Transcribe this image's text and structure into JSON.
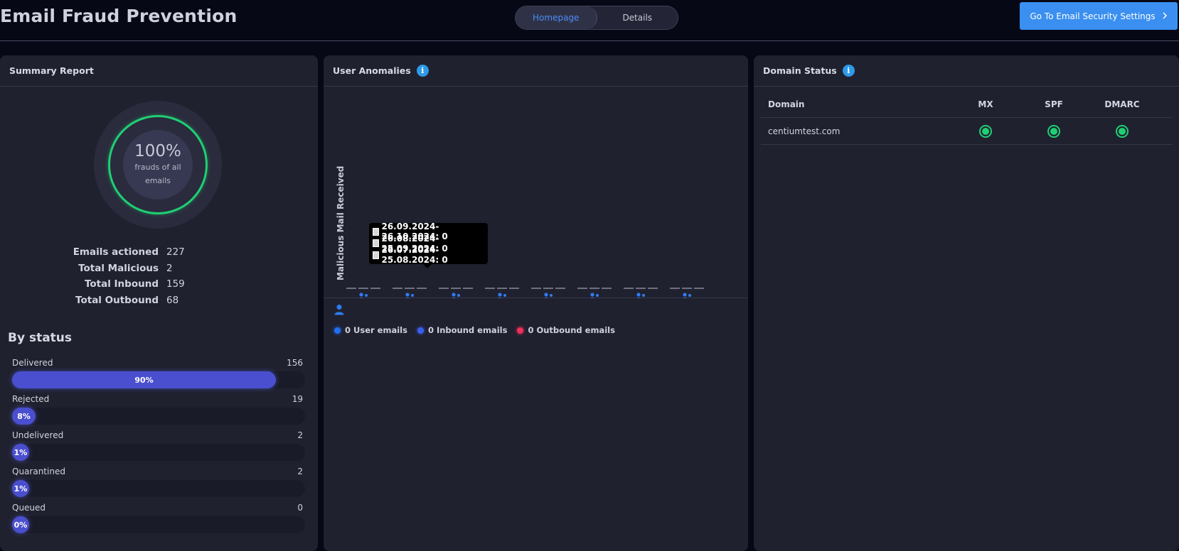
{
  "header": {
    "title": "Email Fraud Prevention",
    "tabs": [
      {
        "label": "Homepage",
        "active": true
      },
      {
        "label": "Details",
        "active": false
      }
    ],
    "settings_button": "Go To Email Security Settings"
  },
  "summary": {
    "title": "Summary Report",
    "donut_pct": "100%",
    "donut_caption": "frauds of all emails",
    "stats": [
      {
        "label": "Emails actioned",
        "value": "227"
      },
      {
        "label": "Total Malicious",
        "value": "2"
      },
      {
        "label": "Total Inbound",
        "value": "159"
      },
      {
        "label": "Total Outbound",
        "value": "68"
      }
    ],
    "by_status_title": "By status",
    "statuses": [
      {
        "label": "Delivered",
        "count": "156",
        "pct": "90%",
        "fraction": 0.9
      },
      {
        "label": "Rejected",
        "count": "19",
        "pct": "8%",
        "fraction": 0.08
      },
      {
        "label": "Undelivered",
        "count": "2",
        "pct": "1%",
        "fraction": 0.01
      },
      {
        "label": "Quarantined",
        "count": "2",
        "pct": "1%",
        "fraction": 0.01
      },
      {
        "label": "Queued",
        "count": "0",
        "pct": "0%",
        "fraction": 0.0
      }
    ]
  },
  "anomalies": {
    "title": "User Anomalies",
    "y_label": "Malicious Mail Received",
    "tooltip": [
      "26.09.2024-26.10.2024: 0",
      "26.08.2024-25.09.2024: 0",
      "26.07.2024-25.08.2024: 0"
    ],
    "legend": [
      {
        "label": "0 User emails",
        "color": "#1f6ff0"
      },
      {
        "label": "0 Inbound emails",
        "color": "#3a5ff0"
      },
      {
        "label": "0 Outbound emails",
        "color": "#f0305a"
      }
    ],
    "user_groups": 8,
    "bars_per_group": 3
  },
  "domain": {
    "title": "Domain Status",
    "columns": [
      "Domain",
      "MX",
      "SPF",
      "DMARC"
    ],
    "rows": [
      {
        "domain": "centiumtest.com",
        "mx": "ok",
        "spf": "ok",
        "dmarc": "ok"
      }
    ]
  },
  "colors": {
    "accent": "#3a8ff0",
    "ok": "#1fcf74",
    "bar": "#4a4fcf"
  }
}
